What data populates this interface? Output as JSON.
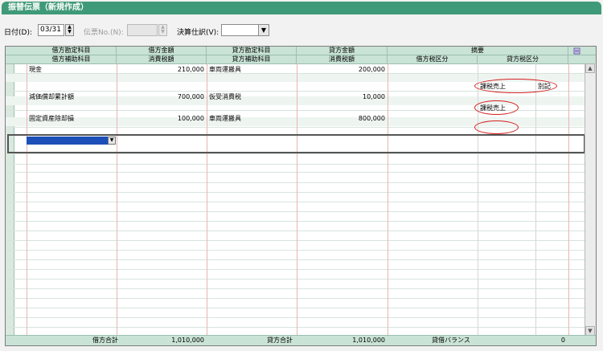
{
  "window": {
    "title": "振替伝票（新規作成）"
  },
  "toolbar": {
    "date_label": "日付(D):",
    "date_value": "03/31",
    "denpyo_label": "伝票No.(N):",
    "denpyo_value": "",
    "kessan_label": "決算仕訳(V):",
    "kessan_value": ""
  },
  "header": {
    "row1": [
      "借方勘定科目",
      "借方金額",
      "貸方勘定科目",
      "貸方金額",
      "摘要"
    ],
    "row2": [
      "借方補助科目",
      "消費税額",
      "貸方補助科目",
      "消費税額",
      "借方税区分",
      "貸方税区分"
    ],
    "memo_icon": "memo-icon"
  },
  "rows": [
    {
      "debit_account": "現金",
      "debit_amount": "210,000",
      "credit_account": "車両運搬具",
      "credit_amount": "200,000",
      "debit_sub": "",
      "debit_tax": "",
      "credit_sub": "",
      "credit_tax": "",
      "debit_taxcat": "",
      "credit_taxcat": "課税売上",
      "credit_taxcat_extra": "別記"
    },
    {
      "debit_account": "減価償却累計額",
      "debit_amount": "700,000",
      "credit_account": "仮受消費税",
      "credit_amount": "10,000",
      "debit_sub": "",
      "debit_tax": "",
      "credit_sub": "",
      "credit_tax": "",
      "debit_taxcat": "",
      "credit_taxcat": "課税売上",
      "credit_taxcat_extra": ""
    },
    {
      "debit_account": "固定資産除却損",
      "debit_amount": "100,000",
      "credit_account": "車両運搬具",
      "credit_amount": "800,000",
      "debit_sub": "",
      "debit_tax": "",
      "credit_sub": "",
      "credit_tax": "",
      "debit_taxcat": "",
      "credit_taxcat": "",
      "credit_taxcat_extra": ""
    }
  ],
  "footer": {
    "debit_total_label": "借方合計",
    "debit_total": "1,010,000",
    "credit_total_label": "貸方合計",
    "credit_total": "1,010,000",
    "balance_label": "貸借バランス",
    "balance": "0"
  },
  "colors": {
    "title_bg": "#3f9a79",
    "header_bg": "#c9e3d6",
    "highlight_oval": "#d42020",
    "selected_cell": "#1d4fb8"
  }
}
